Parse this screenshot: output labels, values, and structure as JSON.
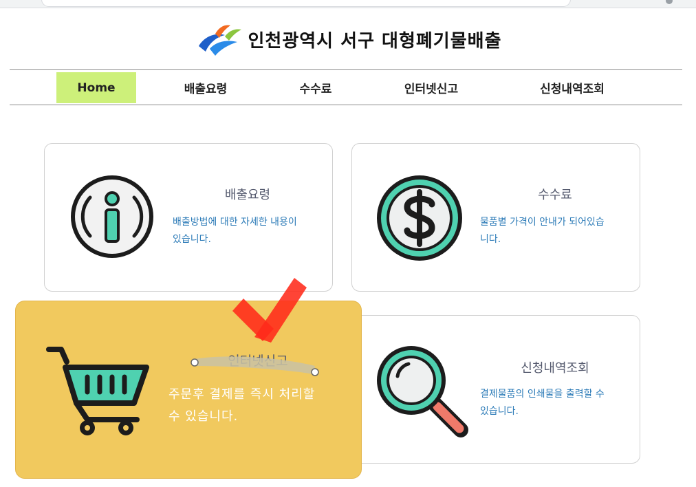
{
  "site": {
    "title": "인천광역시 서구  대형폐기물배출"
  },
  "nav": {
    "items": [
      {
        "label": "Home",
        "active": true
      },
      {
        "label": "배출요령",
        "active": false
      },
      {
        "label": "수수료",
        "active": false
      },
      {
        "label": "인터넷신고",
        "active": false
      },
      {
        "label": "신청내역조회",
        "active": false
      }
    ]
  },
  "cards": [
    {
      "title": "배출요령",
      "desc_line1": "배출방법에 대한 자세한 내용이",
      "desc_line2": "있습니다.",
      "icon": "info-icon"
    },
    {
      "title": "수수료",
      "desc_line1": "물품별 가격이 안내가 되어있습",
      "desc_line2": "니다.",
      "icon": "dollar-icon"
    },
    {
      "title": "인터넷신고",
      "desc_line1": "주문후 결제를 즉시 처리할",
      "desc_line2": "수 있습니다.",
      "icon": "shopping-cart-icon",
      "highlighted": true
    },
    {
      "title": "신청내역조회",
      "desc_line1": "결제물품의 인쇄물을 출력할 수",
      "desc_line2": "있습니다.",
      "icon": "magnifier-icon"
    }
  ],
  "colors": {
    "nav_active": "#cdf07a",
    "highlight_card": "#f1c95e",
    "desc_text": "#2e7cb8",
    "icon_teal": "#4fd1b0",
    "check_mark": "#ff2a1a"
  }
}
